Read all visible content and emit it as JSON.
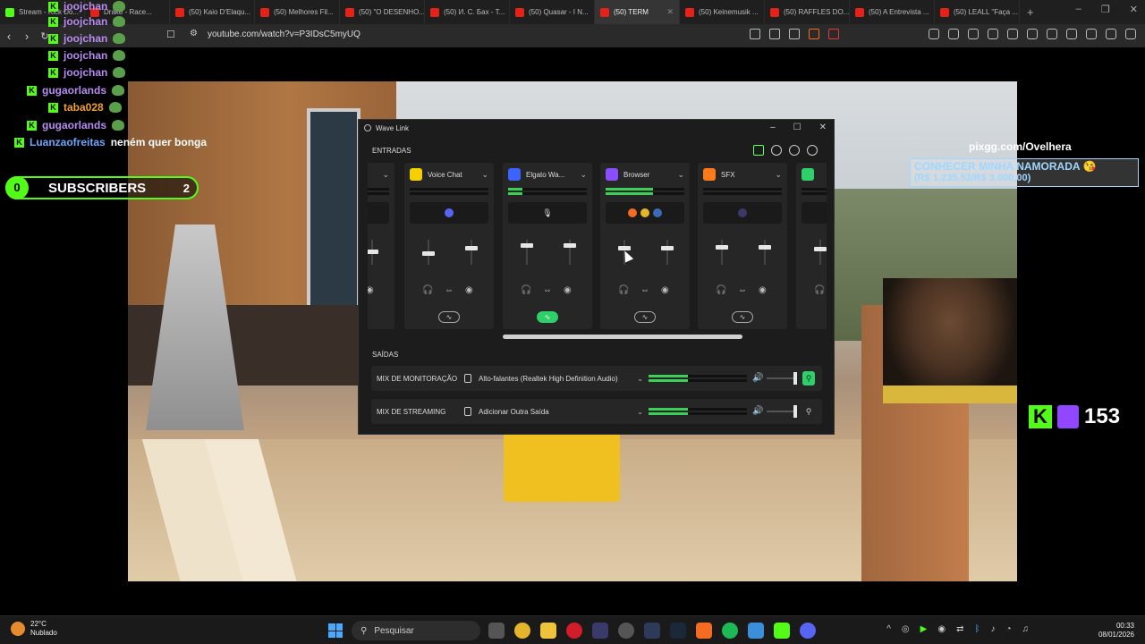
{
  "browser": {
    "tabs": [
      {
        "label": "Stream - Kick Do...",
        "icon": "kick"
      },
      {
        "label": "Drake - Race...",
        "icon": "youtube"
      },
      {
        "label": "(50) Kaio D'Elaqu...",
        "icon": "youtube"
      },
      {
        "label": "(50) Melhores Fil...",
        "icon": "youtube"
      },
      {
        "label": "(50) \"O DESENHO...",
        "icon": "youtube"
      },
      {
        "label": "(50) И. С. Бах - Т...",
        "icon": "youtube"
      },
      {
        "label": "(50) Quasar - I N...",
        "icon": "youtube"
      },
      {
        "label": "(50) TERM",
        "icon": "youtube",
        "active": true
      },
      {
        "label": "(50) Keinemusik ...",
        "icon": "youtube"
      },
      {
        "label": "(50) RAFFLES DO...",
        "icon": "youtube"
      },
      {
        "label": "(50) A Entrevista ...",
        "icon": "youtube"
      },
      {
        "label": "(50) LEALL \"Faça ...",
        "icon": "youtube"
      }
    ],
    "url": "youtube.com/watch?v=P3IDsC5myUQ"
  },
  "chat": {
    "lines": [
      {
        "user": "joojchan",
        "message": "",
        "color": "purple"
      },
      {
        "user": "joojchan",
        "message": "",
        "color": "purple"
      },
      {
        "user": "joojchan",
        "message": "",
        "color": "purple"
      },
      {
        "user": "joojchan",
        "message": "",
        "color": "purple"
      },
      {
        "user": "joojchan",
        "message": "",
        "color": "purple"
      },
      {
        "user": "gugaorlands",
        "message": "",
        "color": "purple"
      },
      {
        "user": "taba028",
        "message": "",
        "color": "orange"
      },
      {
        "user": "gugaorlands",
        "message": "",
        "color": "purple"
      },
      {
        "user": "Luanzaofreitas",
        "message": "neném quer bonga",
        "color": "blue"
      }
    ]
  },
  "subs": {
    "left": "0",
    "label": "SUBSCRIBERS",
    "right": "2"
  },
  "overlay": {
    "pix": "pixgg.com/Ovelhera",
    "goal_title": "CONHECER MINHA NAMORADA 😘",
    "goal_amount": "(R$ 1.235,53/R$ 3.000,00)",
    "viewers": "153"
  },
  "wavelink": {
    "title": "Wave Link",
    "inputs_label": "ENTRADAS",
    "outputs_label": "SAÍDAS",
    "channels": [
      {
        "name": "",
        "color": "#2a2a2a",
        "meter": 0.0,
        "app": "+52",
        "knob_left": 0.4,
        "knob_right": 0.4,
        "wave_on": false
      },
      {
        "name": "Voice Chat",
        "color": "#f5d000",
        "meter": 0.0,
        "app": "discord",
        "knob_left": 0.45,
        "knob_right": 0.25,
        "wave_on": false
      },
      {
        "name": "Elgato Wa...",
        "color": "#3d63ff",
        "meter": 0.18,
        "app": "mic",
        "knob_left": 0.15,
        "knob_right": 0.15,
        "wave_on": true
      },
      {
        "name": "Browser",
        "color": "#8a4dff",
        "meter": 0.6,
        "app": "browsers",
        "knob_left": 0.25,
        "knob_right": 0.25,
        "wave_on": false
      },
      {
        "name": "SFX",
        "color": "#ff7a1a",
        "meter": 0.0,
        "app": "sfx",
        "knob_left": 0.2,
        "knob_right": 0.2,
        "wave_on": false
      },
      {
        "name": "",
        "color": "#2fd06a",
        "meter": 0.0,
        "app": "",
        "knob_left": 0.3,
        "knob_right": 0.3,
        "wave_on": false
      }
    ],
    "mixes": [
      {
        "label": "MIX DE MONITORAÇÃO",
        "device": "Alto-falantes (Realtek High Definition Audio)",
        "meter": 0.4,
        "volume": 1.0,
        "ear_on": true
      },
      {
        "label": "MIX DE STREAMING",
        "device": "Adicionar Outra Saída",
        "meter": 0.4,
        "volume": 1.0,
        "ear_on": false
      }
    ]
  },
  "taskbar": {
    "temperature": "22°C",
    "weather": "Nublado",
    "search_placeholder": "Pesquisar",
    "time": "00:33",
    "date": "08/01/2026"
  }
}
